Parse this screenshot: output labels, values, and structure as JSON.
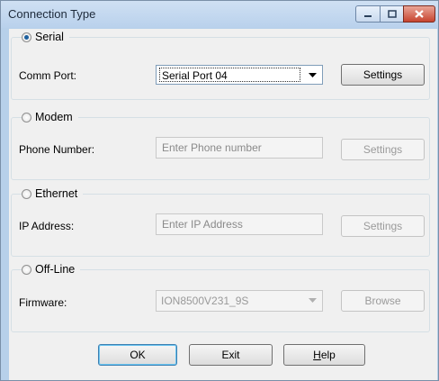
{
  "window": {
    "title": "Connection Type"
  },
  "serial": {
    "label": "Serial",
    "selected": true,
    "field_label": "Comm Port:",
    "value": "Serial Port 04",
    "button": "Settings"
  },
  "modem": {
    "label": "Modem",
    "selected": false,
    "field_label": "Phone Number:",
    "placeholder": "Enter Phone number",
    "button": "Settings"
  },
  "ethernet": {
    "label": "Ethernet",
    "selected": false,
    "field_label": "IP Address:",
    "placeholder": "Enter IP Address",
    "button": "Settings"
  },
  "offline": {
    "label": "Off-Line",
    "selected": false,
    "field_label": "Firmware:",
    "value": "ION8500V231_9S",
    "button": "Browse"
  },
  "footer": {
    "ok": "OK",
    "exit": "Exit",
    "help_mnemonic": "H",
    "help_rest": "elp"
  },
  "icons": {
    "minimize": "minimize-icon",
    "maximize": "maximize-icon",
    "close": "close-icon",
    "dropdown": "chevron-down-icon"
  }
}
